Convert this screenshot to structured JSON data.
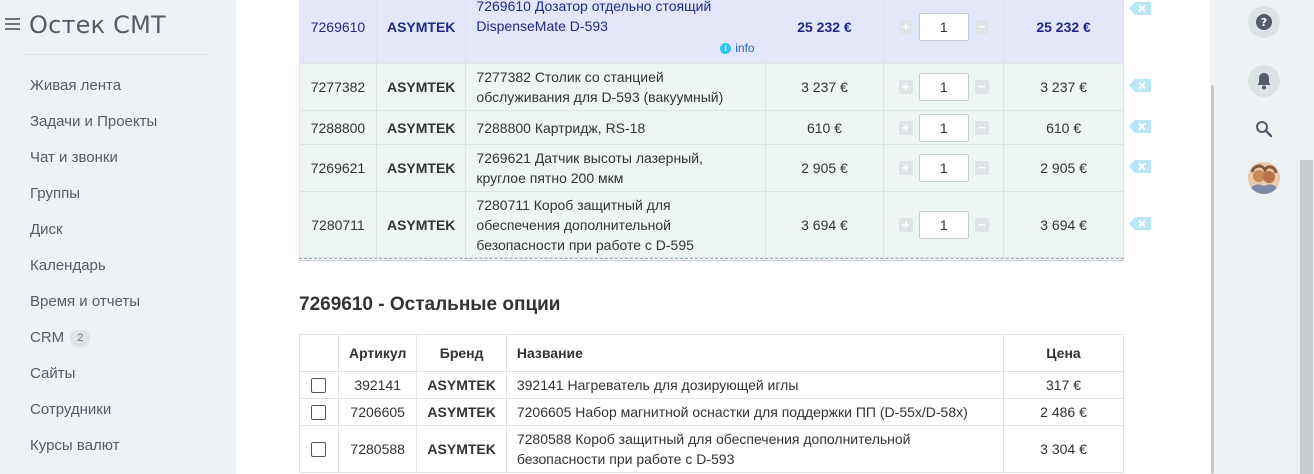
{
  "app": {
    "title": "Остек СМТ"
  },
  "sidebar": {
    "items": [
      {
        "label": "Живая лента"
      },
      {
        "label": "Задачи и Проекты"
      },
      {
        "label": "Чат и звонки"
      },
      {
        "label": "Группы"
      },
      {
        "label": "Диск"
      },
      {
        "label": "Календарь"
      },
      {
        "label": "Время и отчеты"
      },
      {
        "label": "CRM",
        "badge": "2"
      },
      {
        "label": "Сайты"
      },
      {
        "label": "Сотрудники"
      },
      {
        "label": "Курсы валют"
      }
    ]
  },
  "products": {
    "rows": [
      {
        "article": "7269610",
        "brand": "ASYMTEK",
        "name": "7269610 Дозатор отдельно стоящий DispenseMate D-593",
        "price": "25 232 €",
        "qty": "1",
        "total": "25 232 €",
        "info": "info"
      },
      {
        "article": "7277382",
        "brand": "ASYMTEK",
        "name": "7277382 Столик со станцией обслуживания для D-593 (вакуумный)",
        "price": "3 237 €",
        "qty": "1",
        "total": "3 237 €"
      },
      {
        "article": "7288800",
        "brand": "ASYMTEK",
        "name": "7288800 Картридж, RS-18",
        "price": "610 €",
        "qty": "1",
        "total": "610 €"
      },
      {
        "article": "7269621",
        "brand": "ASYMTEK",
        "name": "7269621 Датчик высоты лазерный, круглое пятно 200 мкм",
        "price": "2 905 €",
        "qty": "1",
        "total": "2 905 €"
      },
      {
        "article": "7280711",
        "brand": "ASYMTEK",
        "name": "7280711 Короб защитный для обеспечения дополнительной безопасности при работе с D-595",
        "price": "3 694 €",
        "qty": "1",
        "total": "3 694 €"
      }
    ]
  },
  "options": {
    "title": "7269610 - Остальные опции",
    "headers": {
      "article": "Артикул",
      "brand": "Бренд",
      "name": "Название",
      "price": "Цена"
    },
    "rows": [
      {
        "article": "392141",
        "brand": "ASYMTEK",
        "name": "392141 Нагреватель для дозирующей иглы",
        "price": "317 €"
      },
      {
        "article": "7206605",
        "brand": "ASYMTEK",
        "name": "7206605 Набор магнитной оснастки для поддержки ПП (D-55x/D-58x)",
        "price": "2 486 €"
      },
      {
        "article": "7280588",
        "brand": "ASYMTEK",
        "name": "7280588 Короб защитный для обеспечения дополнительной безопасности при работе с D-593",
        "price": "3 304 €"
      }
    ]
  },
  "colors": {
    "selected_row": "#e4e6fa",
    "row": "#eef6f3",
    "delete": "#b9e6f5",
    "info": "#2fc6f6"
  },
  "icons": {
    "rail": [
      "help-icon",
      "bell-icon",
      "search-icon",
      "avatar"
    ],
    "delete": "delete-icon",
    "qty_plus": "plus-icon",
    "qty_minus": "minus-icon"
  }
}
